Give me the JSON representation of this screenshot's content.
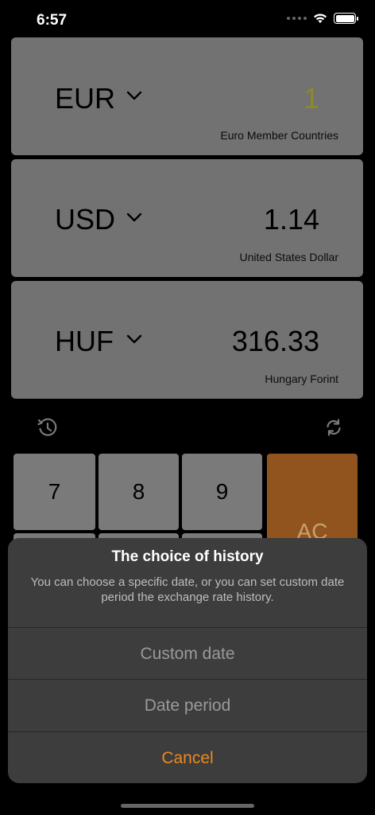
{
  "status_bar": {
    "time": "6:57"
  },
  "currencies": [
    {
      "code": "EUR",
      "value": "1",
      "name": "Euro Member Countries"
    },
    {
      "code": "USD",
      "value": "1.14",
      "name": "United States Dollar"
    },
    {
      "code": "HUF",
      "value": "316.33",
      "name": "Hungary Forint"
    }
  ],
  "keypad": {
    "keys": [
      "7",
      "8",
      "9"
    ],
    "clear_label": "AC"
  },
  "icons": {
    "history": "history-icon",
    "swap": "refresh-icon"
  },
  "action_sheet": {
    "title": "The choice of history",
    "message": "You can choose a specific date, or you can set custom date period the exchange rate history.",
    "options": [
      "Custom date",
      "Date period"
    ],
    "cancel": "Cancel"
  },
  "colors": {
    "accent": "#e88a1f",
    "active_value": "#8a8a2a"
  }
}
